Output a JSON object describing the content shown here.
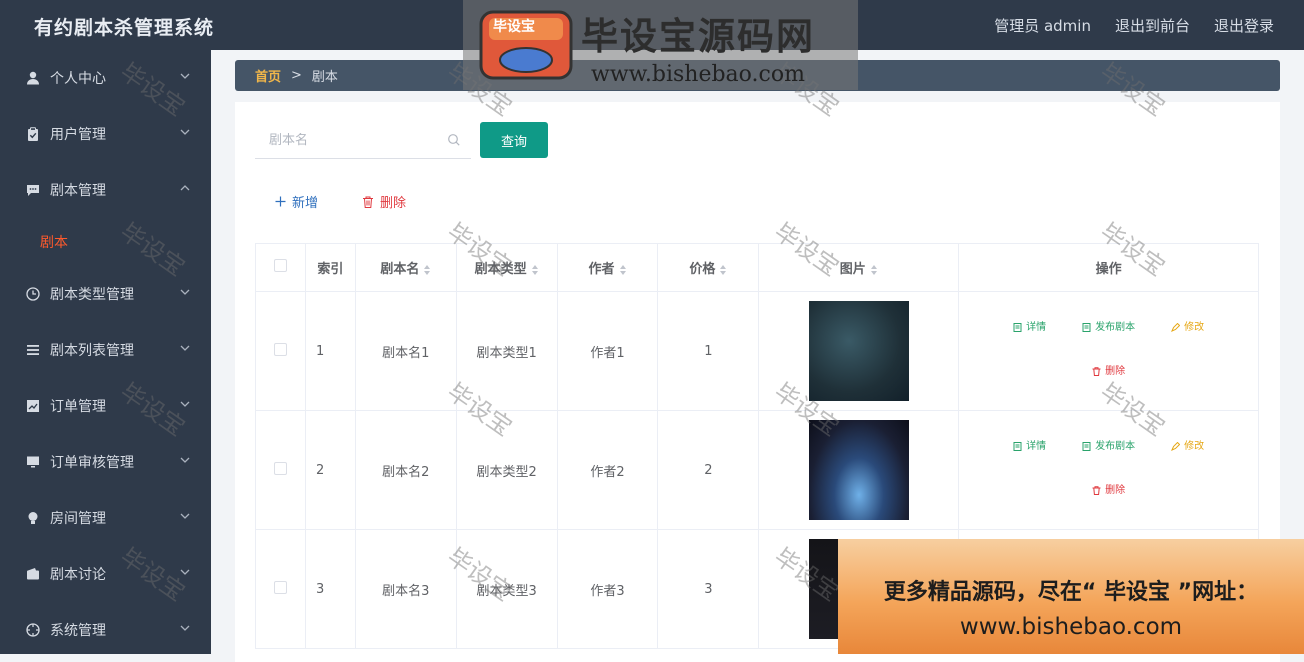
{
  "header": {
    "title": "有约剧本杀管理系统",
    "user_label": "管理员 admin",
    "to_front": "退出到前台",
    "logout": "退出登录"
  },
  "sidebar": {
    "items": [
      {
        "label": "个人中心",
        "icon": "person-icon",
        "chevron": "down"
      },
      {
        "label": "用户管理",
        "icon": "clipboard-icon",
        "chevron": "down"
      },
      {
        "label": "剧本管理",
        "icon": "chat-icon",
        "chevron": "up"
      },
      {
        "label": "剧本类型管理",
        "icon": "clock-icon",
        "chevron": "down"
      },
      {
        "label": "剧本列表管理",
        "icon": "list-icon",
        "chevron": "down"
      },
      {
        "label": "订单管理",
        "icon": "chart-icon",
        "chevron": "down"
      },
      {
        "label": "订单审核管理",
        "icon": "monitor-icon",
        "chevron": "down"
      },
      {
        "label": "房间管理",
        "icon": "bulb-icon",
        "chevron": "down"
      },
      {
        "label": "剧本讨论",
        "icon": "wallet-icon",
        "chevron": "down"
      },
      {
        "label": "系统管理",
        "icon": "compass-icon",
        "chevron": "down"
      }
    ],
    "active_sub": "剧本"
  },
  "breadcrumb": {
    "home": "首页",
    "current": "剧本"
  },
  "search": {
    "placeholder": "剧本名",
    "button": "查询"
  },
  "actions": {
    "add": "新增",
    "delete": "删除"
  },
  "table": {
    "headers": [
      "索引",
      "剧本名",
      "剧本类型",
      "作者",
      "价格",
      "图片",
      "操作"
    ],
    "rows": [
      {
        "index": "1",
        "name": "剧本名1",
        "type": "剧本类型1",
        "author": "作者1",
        "price": "1"
      },
      {
        "index": "2",
        "name": "剧本名2",
        "type": "剧本类型2",
        "author": "作者2",
        "price": "2"
      },
      {
        "index": "3",
        "name": "剧本名3",
        "type": "剧本类型3",
        "author": "作者3",
        "price": "3"
      }
    ],
    "ops": {
      "detail": "详情",
      "publish": "发布剧本",
      "edit": "修改",
      "delete": "删除"
    }
  },
  "watermark": {
    "logo_badge": "毕设宝",
    "logo_title": "毕设宝源码网",
    "logo_url": "www.bishebao.com",
    "tile_text": "毕设宝"
  },
  "promo": {
    "line1": "更多精品源码，尽在“ 毕设宝 ”网址：",
    "line2": "www.bishebao.com"
  },
  "colors": {
    "accent": "#0f9a87",
    "active_sub": "#ff5a2c",
    "sidebar_bg": "#2f3a4a"
  }
}
